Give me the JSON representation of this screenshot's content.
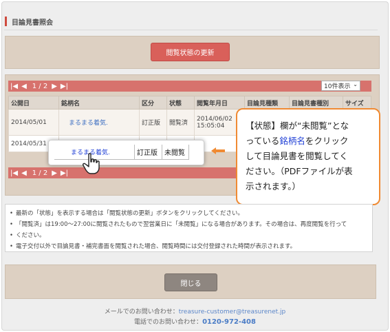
{
  "page": {
    "title": "目論見書照会"
  },
  "update": {
    "button_label": "閲覧状態の更新"
  },
  "pager": {
    "first": "|◀",
    "prev": "◀",
    "page_indicator": "1 / 2",
    "next": "▶",
    "last": "▶|",
    "per_page": "10件表示"
  },
  "table": {
    "headers": [
      "公開日",
      "銘柄名",
      "区分",
      "状態",
      "閲覧年月日",
      "目論見種類",
      "目論見書種別",
      "サイズ"
    ],
    "rows": [
      {
        "date": "2014/05/01",
        "name": "まるまる着気.",
        "type": "訂正版",
        "status": "閲覧済",
        "viewed_date": "2014/06/02",
        "viewed_time": "15:05:04"
      },
      {
        "date": "2014/05/31"
      }
    ]
  },
  "zoom": {
    "name": "まるまる着気.",
    "type": "訂正版",
    "status": "未閲覧"
  },
  "callout": {
    "line1": "【状態】欄が“未閲覧”とな",
    "line2_pre": "っている",
    "line2_link": "銘柄名",
    "line2_post": "をクリック",
    "line3": "して目論見書を閲覧してく",
    "line4": "ださい。（PDFファイルが表",
    "line5": "示されます。）"
  },
  "notes": [
    "最新の「状態」を表示する場合は「閲覧状態の更新」ボタンをクリックしてください。",
    "「閲覧済」は19:00～27:00に閲覧されたもので翌営業日に「未閲覧」になる場合があります。その場合は、再度閲覧を行って",
    "ください。",
    "電子交付以外で目論見書・補完書面を閲覧された場合、閲覧時間には交付登録された時間が表示されます。"
  ],
  "close": {
    "button_label": "閉じる"
  },
  "contact": {
    "mail_label": "メールでのお問い合わせ：",
    "mail_value": "treasure-customer@treasurenet.jp",
    "tel_label": "電話でのお問い合わせ：",
    "tel_value": "0120-972-408"
  },
  "colors": {
    "accent": "#d9605a",
    "callout_border": "#f08a32",
    "link": "#1f3fd6",
    "panel": "#ddd0c2"
  }
}
